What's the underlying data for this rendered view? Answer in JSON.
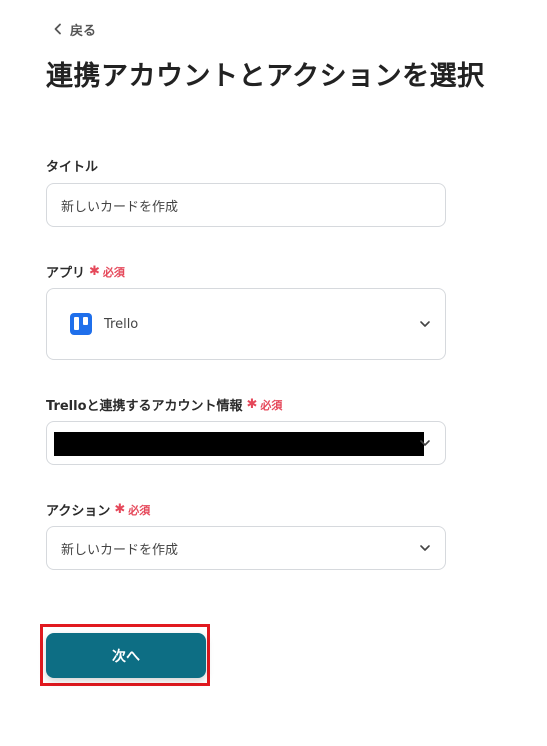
{
  "back_label": "戻る",
  "page_title": "連携アカウントとアクションを選択",
  "required_text": "必須",
  "title_field": {
    "label": "タイトル",
    "value": "新しいカードを作成"
  },
  "app_field": {
    "label": "アプリ",
    "value": "Trello",
    "icon": "trello-logo-icon"
  },
  "account_field": {
    "label": "Trelloと連携するアカウント情報",
    "value_redacted": true
  },
  "action_field": {
    "label": "アクション",
    "value": "新しいカードを作成"
  },
  "next_button": {
    "label": "次へ",
    "highlighted": true
  },
  "colors": {
    "accent": "#0d6e84",
    "required": "#e5485a",
    "highlight": "#e1191f",
    "trello": "#1f6feb"
  }
}
